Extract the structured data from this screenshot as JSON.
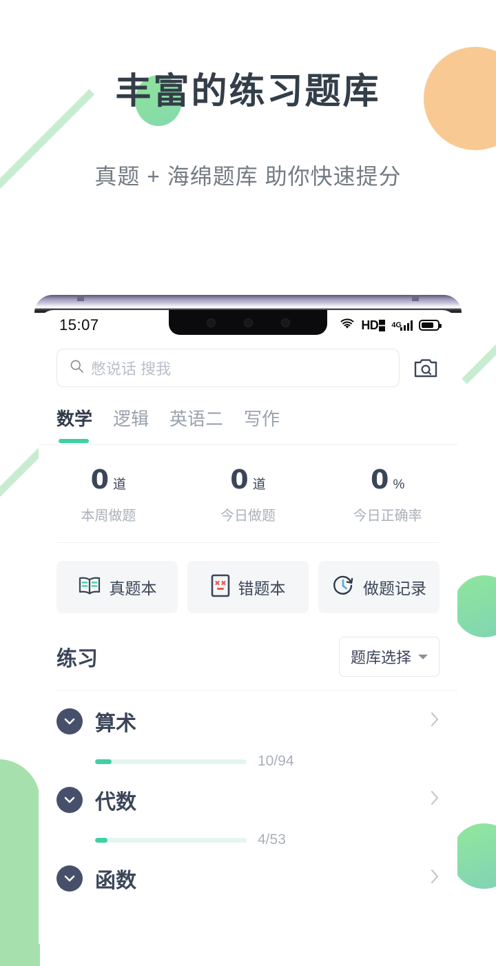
{
  "promo": {
    "title": "丰富的练习题库",
    "subtitle": "真题 + 海绵题库 助你快速提分"
  },
  "colors": {
    "accent_green": "#3fd0a4",
    "deco_orange": "#f9c993",
    "deco_green": "#a5e0ad",
    "dark_navy": "#3b4559",
    "badge_navy": "#46506b"
  },
  "phone": {
    "statusbar": {
      "time": "15:07",
      "icons": [
        "wifi-icon",
        "hd-voice-icon",
        "signal-4g-icon",
        "battery-icon"
      ],
      "hd_label": "HD",
      "network_label": "4G"
    },
    "search": {
      "placeholder": "憋说话 搜我",
      "value": "",
      "search_icon": "search-icon",
      "camera_icon": "camera-search-icon"
    },
    "tabs": [
      {
        "label": "数学",
        "active": true
      },
      {
        "label": "逻辑",
        "active": false
      },
      {
        "label": "英语二",
        "active": false
      },
      {
        "label": "写作",
        "active": false
      }
    ],
    "stats": [
      {
        "value": "0",
        "unit": "道",
        "label": "本周做题"
      },
      {
        "value": "0",
        "unit": "道",
        "label": "今日做题"
      },
      {
        "value": "0",
        "unit": "%",
        "label": "今日正确率"
      }
    ],
    "actions": [
      {
        "label": "真题本",
        "icon": "open-book-icon"
      },
      {
        "label": "错题本",
        "icon": "wrong-answer-paper-icon"
      },
      {
        "label": "做题记录",
        "icon": "clock-history-icon"
      }
    ],
    "practice": {
      "title": "练习",
      "qbank_button": "题库选择",
      "items": [
        {
          "name": "算术",
          "done": 10,
          "total": 94,
          "count_label": "10/94",
          "percent": 11
        },
        {
          "name": "代数",
          "done": 4,
          "total": 53,
          "count_label": "4/53",
          "percent": 8
        },
        {
          "name": "函数",
          "done": 0,
          "total": 0,
          "count_label": "",
          "percent": 0
        }
      ]
    }
  }
}
